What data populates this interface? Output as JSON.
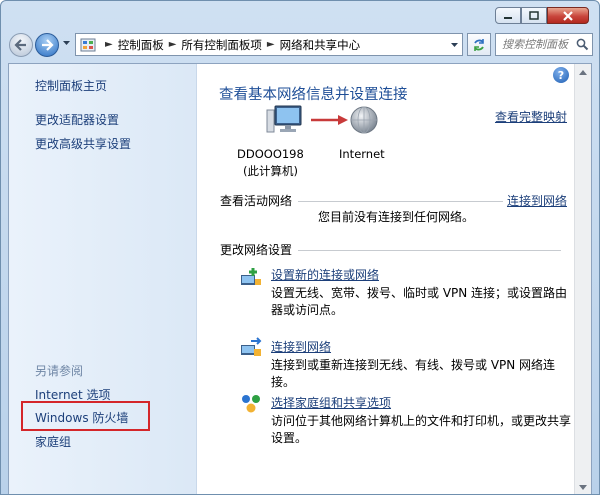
{
  "window": {
    "buttons": [
      "minimize",
      "maximize",
      "close"
    ]
  },
  "address": {
    "crumbs": [
      "控制面板",
      "所有控制面板项",
      "网络和共享中心"
    ]
  },
  "search": {
    "placeholder": "搜索控制面板"
  },
  "sidebar": {
    "top_links": [
      "控制面板主页",
      "更改适配器设置",
      "更改高级共享设置"
    ],
    "see_also_label": "另请参阅",
    "see_also_links": [
      "Internet 选项",
      "Windows 防火墙",
      "家庭组"
    ]
  },
  "main": {
    "title": "查看基本网络信息并设置连接",
    "full_map_link": "查看完整映射",
    "help_label": "?",
    "map": {
      "computer_name": "DDOOO198",
      "computer_sub": "(此计算机)",
      "internet_label": "Internet"
    },
    "active": {
      "heading": "查看活动网络",
      "connect_link": "连接到网络",
      "status": "您目前没有连接到任何网络。"
    },
    "change": {
      "heading": "更改网络设置",
      "tasks": [
        {
          "title": "设置新的连接或网络",
          "desc": "设置无线、宽带、拨号、临时或 VPN 连接；或设置路由器或访问点。",
          "icon": "new-connection-icon"
        },
        {
          "title": "连接到网络",
          "desc": "连接到或重新连接到无线、有线、拨号或 VPN 网络连接。",
          "icon": "connect-network-icon"
        },
        {
          "title": "选择家庭组和共享选项",
          "desc": "访问位于其他网络计算机上的文件和打印机，或更改共享设置。",
          "icon": "homegroup-icon"
        }
      ]
    }
  },
  "colors": {
    "link": "#1c3f7a",
    "title": "#1e4e97",
    "highlight_box": "#d4262a"
  }
}
